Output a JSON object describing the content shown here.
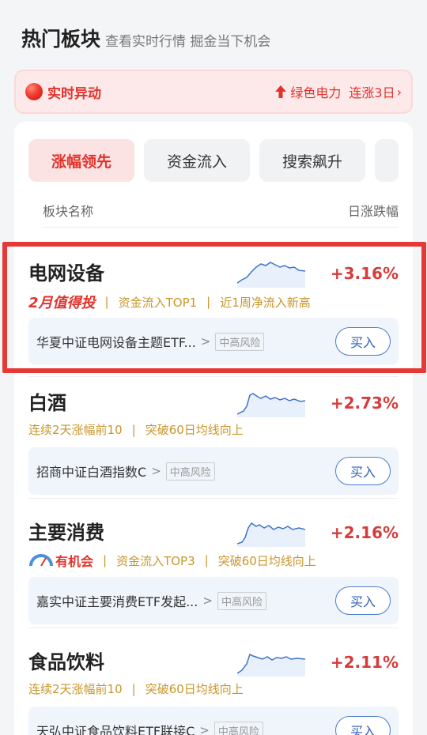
{
  "header": {
    "title": "热门板块",
    "subtitle": "查看实时行情 掘金当下机会"
  },
  "banner": {
    "label": "实时异动",
    "sector": "绿色电力",
    "streak": "连涨3日",
    "chev": "›"
  },
  "tabs": [
    {
      "label": "涨幅领先",
      "active": true
    },
    {
      "label": "资金流入",
      "active": false
    },
    {
      "label": "搜索飙升",
      "active": false
    }
  ],
  "columns": {
    "name": "板块名称",
    "change": "日涨跌幅"
  },
  "sectors": [
    {
      "name": "电网设备",
      "change": "+3.16%",
      "badge": "2月值得投",
      "tag1": "资金流入TOP1",
      "tag2": "近1周净流入新高",
      "fund": "华夏中证电网设备主题ETF...",
      "gt": ">",
      "risk": "中高风险",
      "buy": "买入"
    },
    {
      "name": "白酒",
      "change": "+2.73%",
      "tag1": "连续2天涨幅前10",
      "tag2": "突破60日均线向上",
      "fund": "招商中证白酒指数C",
      "gt": ">",
      "risk": "中高风险",
      "buy": "买入"
    },
    {
      "name": "主要消费",
      "change": "+2.16%",
      "badge": "有机会",
      "tag1": "资金流入TOP3",
      "tag2": "突破60日均线向上",
      "fund": "嘉实中证主要消费ETF发起...",
      "gt": ">",
      "risk": "中高风险",
      "buy": "买入"
    },
    {
      "name": "食品饮料",
      "change": "+2.11%",
      "tag1": "连续2天涨幅前10",
      "tag2": "突破60日均线向上",
      "fund": "天弘中证食品饮料ETF联接C",
      "gt": ">",
      "risk": "中高风险",
      "buy": "买入"
    }
  ],
  "sep": "|",
  "colors": {
    "accent_red": "#e2322b",
    "gain": "#d83b3b",
    "tag_gold": "#c9962a",
    "buy_blue": "#2f5fb8"
  },
  "icons": [
    "fire-dot-icon",
    "up-arrow-icon",
    "gauge-icon",
    "chevron-right-icon"
  ]
}
